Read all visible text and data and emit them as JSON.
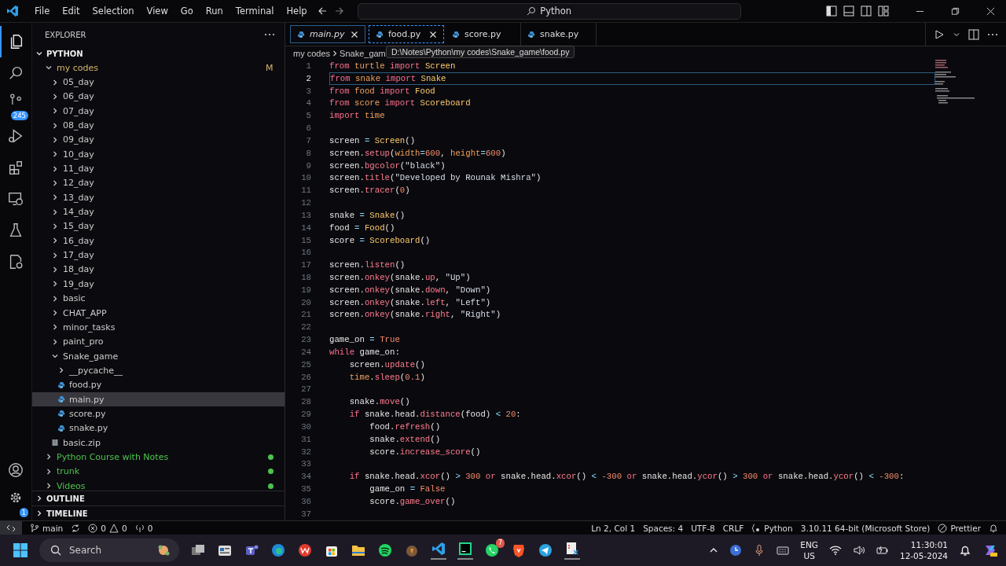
{
  "title_bar": {
    "menu": [
      "File",
      "Edit",
      "Selection",
      "View",
      "Go",
      "Run",
      "Terminal",
      "Help"
    ],
    "search": "Python"
  },
  "activity_bar": {
    "source_control_badge": "245",
    "settings_badge": "1"
  },
  "explorer": {
    "title": "EXPLORER",
    "section": "PYTHON",
    "tree": [
      {
        "label": "my codes",
        "kind": "folder",
        "expanded": true,
        "color": "#d7b46a",
        "decoration": "M",
        "children": [
          {
            "label": "05_day",
            "kind": "folder",
            "expanded": false
          },
          {
            "label": "06_day",
            "kind": "folder",
            "expanded": false
          },
          {
            "label": "07_day",
            "kind": "folder",
            "expanded": false
          },
          {
            "label": "08_day",
            "kind": "folder",
            "expanded": false
          },
          {
            "label": "09_day",
            "kind": "folder",
            "expanded": false
          },
          {
            "label": "10_day",
            "kind": "folder",
            "expanded": false
          },
          {
            "label": "11_day",
            "kind": "folder",
            "expanded": false
          },
          {
            "label": "12_day",
            "kind": "folder",
            "expanded": false
          },
          {
            "label": "13_day",
            "kind": "folder",
            "expanded": false
          },
          {
            "label": "14_day",
            "kind": "folder",
            "expanded": false
          },
          {
            "label": "15_day",
            "kind": "folder",
            "expanded": false
          },
          {
            "label": "16_day",
            "kind": "folder",
            "expanded": false
          },
          {
            "label": "17_day",
            "kind": "folder",
            "expanded": false
          },
          {
            "label": "18_day",
            "kind": "folder",
            "expanded": false
          },
          {
            "label": "19_day",
            "kind": "folder",
            "expanded": false
          },
          {
            "label": "basic",
            "kind": "folder",
            "expanded": false
          },
          {
            "label": "CHAT_APP",
            "kind": "folder",
            "expanded": false
          },
          {
            "label": "minor_tasks",
            "kind": "folder",
            "expanded": false
          },
          {
            "label": "paint_pro",
            "kind": "folder",
            "expanded": false
          },
          {
            "label": "Snake_game",
            "kind": "folder",
            "expanded": true,
            "children": [
              {
                "label": "__pycache__",
                "kind": "folder",
                "expanded": false
              },
              {
                "label": "food.py",
                "kind": "file",
                "selected": false
              },
              {
                "label": "main.py",
                "kind": "file",
                "selected": true
              },
              {
                "label": "score.py",
                "kind": "file",
                "selected": false
              },
              {
                "label": "snake.py",
                "kind": "file",
                "selected": false
              }
            ]
          },
          {
            "label": "basic.zip",
            "kind": "archive",
            "selected": false
          }
        ]
      },
      {
        "label": "Python Course with Notes",
        "kind": "folder",
        "expanded": false,
        "color": "#4cc34c",
        "dot": true
      },
      {
        "label": "trunk",
        "kind": "folder",
        "expanded": false,
        "color": "#4cc34c",
        "dot": true
      },
      {
        "label": "Videos",
        "kind": "folder",
        "expanded": false,
        "color": "#4cc34c",
        "dot": true
      }
    ],
    "panels": [
      "OUTLINE",
      "TIMELINE"
    ]
  },
  "tabs": [
    {
      "label": "main.py",
      "selected": true,
      "preview": true,
      "close_visible": true
    },
    {
      "label": "food.py",
      "selected": false,
      "preview": false,
      "close_visible": true
    },
    {
      "label": "score.py",
      "selected": false,
      "preview": false,
      "close_visible": false
    },
    {
      "label": "snake.py",
      "selected": false,
      "preview": false,
      "close_visible": false
    }
  ],
  "breadcrumb": [
    "my codes",
    "Snake_gam"
  ],
  "tooltip": "D:\\Notes\\Python\\my codes\\Snake_game\\food.py",
  "code": [
    {
      "number": "1",
      "current": false,
      "tokens": [
        {
          "kind": "kw",
          "text": "from "
        },
        {
          "kind": "mod",
          "text": "turtle "
        },
        {
          "kind": "kw",
          "text": "import "
        },
        {
          "kind": "cls",
          "text": "Screen"
        }
      ]
    },
    {
      "number": "2",
      "current": true,
      "tokens": [
        {
          "kind": "kw",
          "text": "from "
        },
        {
          "kind": "mod",
          "text": "snake "
        },
        {
          "kind": "kw",
          "text": "import "
        },
        {
          "kind": "cls",
          "text": "Snake"
        }
      ]
    },
    {
      "number": "3",
      "current": false,
      "tokens": [
        {
          "kind": "kw",
          "text": "from "
        },
        {
          "kind": "mod",
          "text": "food "
        },
        {
          "kind": "kw",
          "text": "import "
        },
        {
          "kind": "cls",
          "text": "Food"
        }
      ]
    },
    {
      "number": "4",
      "current": false,
      "tokens": [
        {
          "kind": "kw",
          "text": "from "
        },
        {
          "kind": "mod",
          "text": "score "
        },
        {
          "kind": "kw",
          "text": "import "
        },
        {
          "kind": "cls",
          "text": "Scoreboard"
        }
      ]
    },
    {
      "number": "5",
      "current": false,
      "tokens": [
        {
          "kind": "kw",
          "text": "import "
        },
        {
          "kind": "mod",
          "text": "time"
        }
      ]
    },
    {
      "number": "6",
      "current": false
    },
    {
      "number": "7",
      "current": false,
      "tokens": [
        {
          "kind": "var",
          "text": "screen "
        },
        {
          "kind": "op",
          "text": "= "
        },
        {
          "kind": "cls",
          "text": "Screen"
        },
        {
          "kind": "var",
          "text": "()"
        }
      ]
    },
    {
      "number": "8",
      "current": false,
      "tokens": [
        {
          "kind": "var",
          "text": "screen."
        },
        {
          "kind": "fn",
          "text": "setup"
        },
        {
          "kind": "var",
          "text": "("
        },
        {
          "kind": "param",
          "text": "width"
        },
        {
          "kind": "op",
          "text": "="
        },
        {
          "kind": "num",
          "text": "600"
        },
        {
          "kind": "var",
          "text": ", "
        },
        {
          "kind": "param",
          "text": "height"
        },
        {
          "kind": "op",
          "text": "="
        },
        {
          "kind": "num",
          "text": "600"
        },
        {
          "kind": "var",
          "text": ")"
        }
      ]
    },
    {
      "number": "9",
      "current": false,
      "tokens": [
        {
          "kind": "var",
          "text": "screen."
        },
        {
          "kind": "fn",
          "text": "bgcolor"
        },
        {
          "kind": "var",
          "text": "("
        },
        {
          "kind": "str",
          "text": "\"black\""
        },
        {
          "kind": "var",
          "text": ")"
        }
      ]
    },
    {
      "number": "10",
      "current": false,
      "tokens": [
        {
          "kind": "var",
          "text": "screen."
        },
        {
          "kind": "fn",
          "text": "title"
        },
        {
          "kind": "var",
          "text": "("
        },
        {
          "kind": "str",
          "text": "\"Developed by Rounak Mishra\""
        },
        {
          "kind": "var",
          "text": ")"
        }
      ]
    },
    {
      "number": "11",
      "current": false,
      "tokens": [
        {
          "kind": "var",
          "text": "screen."
        },
        {
          "kind": "fn",
          "text": "tracer"
        },
        {
          "kind": "var",
          "text": "("
        },
        {
          "kind": "num",
          "text": "0"
        },
        {
          "kind": "var",
          "text": ")"
        }
      ]
    },
    {
      "number": "12",
      "current": false
    },
    {
      "number": "13",
      "current": false,
      "tokens": [
        {
          "kind": "var",
          "text": "snake "
        },
        {
          "kind": "op",
          "text": "= "
        },
        {
          "kind": "cls",
          "text": "Snake"
        },
        {
          "kind": "var",
          "text": "()"
        }
      ]
    },
    {
      "number": "14",
      "current": false,
      "tokens": [
        {
          "kind": "var",
          "text": "food "
        },
        {
          "kind": "op",
          "text": "= "
        },
        {
          "kind": "cls",
          "text": "Food"
        },
        {
          "kind": "var",
          "text": "()"
        }
      ]
    },
    {
      "number": "15",
      "current": false,
      "tokens": [
        {
          "kind": "var",
          "text": "score "
        },
        {
          "kind": "op",
          "text": "= "
        },
        {
          "kind": "cls",
          "text": "Scoreboard"
        },
        {
          "kind": "var",
          "text": "()"
        }
      ]
    },
    {
      "number": "16",
      "current": false
    },
    {
      "number": "17",
      "current": false,
      "tokens": [
        {
          "kind": "var",
          "text": "screen."
        },
        {
          "kind": "fn",
          "text": "listen"
        },
        {
          "kind": "var",
          "text": "()"
        }
      ]
    },
    {
      "number": "18",
      "current": false,
      "tokens": [
        {
          "kind": "var",
          "text": "screen."
        },
        {
          "kind": "fn",
          "text": "onkey"
        },
        {
          "kind": "var",
          "text": "(snake."
        },
        {
          "kind": "fn",
          "text": "up"
        },
        {
          "kind": "var",
          "text": ", "
        },
        {
          "kind": "str",
          "text": "\"Up\""
        },
        {
          "kind": "var",
          "text": ")"
        }
      ]
    },
    {
      "number": "19",
      "current": false,
      "tokens": [
        {
          "kind": "var",
          "text": "screen."
        },
        {
          "kind": "fn",
          "text": "onkey"
        },
        {
          "kind": "var",
          "text": "(snake."
        },
        {
          "kind": "fn",
          "text": "down"
        },
        {
          "kind": "var",
          "text": ", "
        },
        {
          "kind": "str",
          "text": "\"Down\""
        },
        {
          "kind": "var",
          "text": ")"
        }
      ]
    },
    {
      "number": "20",
      "current": false,
      "tokens": [
        {
          "kind": "var",
          "text": "screen."
        },
        {
          "kind": "fn",
          "text": "onkey"
        },
        {
          "kind": "var",
          "text": "(snake."
        },
        {
          "kind": "fn",
          "text": "left"
        },
        {
          "kind": "var",
          "text": ", "
        },
        {
          "kind": "str",
          "text": "\"Left\""
        },
        {
          "kind": "var",
          "text": ")"
        }
      ]
    },
    {
      "number": "21",
      "current": false,
      "tokens": [
        {
          "kind": "var",
          "text": "screen."
        },
        {
          "kind": "fn",
          "text": "onkey"
        },
        {
          "kind": "var",
          "text": "(snake."
        },
        {
          "kind": "fn",
          "text": "right"
        },
        {
          "kind": "var",
          "text": ", "
        },
        {
          "kind": "str",
          "text": "\"Right\""
        },
        {
          "kind": "var",
          "text": ")"
        }
      ]
    },
    {
      "number": "22",
      "current": false
    },
    {
      "number": "23",
      "current": false,
      "tokens": [
        {
          "kind": "var",
          "text": "game_on "
        },
        {
          "kind": "op",
          "text": "= "
        },
        {
          "kind": "num",
          "text": "True"
        }
      ]
    },
    {
      "number": "24",
      "current": false,
      "tokens": [
        {
          "kind": "kw",
          "text": "while "
        },
        {
          "kind": "var",
          "text": "game_on:"
        }
      ]
    },
    {
      "number": "25",
      "current": false,
      "tokens": [
        {
          "kind": "var",
          "text": "    screen."
        },
        {
          "kind": "fn",
          "text": "update"
        },
        {
          "kind": "var",
          "text": "()"
        }
      ]
    },
    {
      "number": "26",
      "current": false,
      "tokens": [
        {
          "kind": "mod",
          "text": "    time"
        },
        {
          "kind": "var",
          "text": "."
        },
        {
          "kind": "fn",
          "text": "sleep"
        },
        {
          "kind": "var",
          "text": "("
        },
        {
          "kind": "num",
          "text": "0.1"
        },
        {
          "kind": "var",
          "text": ")"
        }
      ]
    },
    {
      "number": "27",
      "current": false
    },
    {
      "number": "28",
      "current": false,
      "tokens": [
        {
          "kind": "var",
          "text": "    snake."
        },
        {
          "kind": "fn",
          "text": "move"
        },
        {
          "kind": "var",
          "text": "()"
        }
      ]
    },
    {
      "number": "29",
      "current": false,
      "tokens": [
        {
          "kind": "kw",
          "text": "    if "
        },
        {
          "kind": "var",
          "text": "snake.head."
        },
        {
          "kind": "fn",
          "text": "distance"
        },
        {
          "kind": "var",
          "text": "(food) "
        },
        {
          "kind": "op",
          "text": "< "
        },
        {
          "kind": "num",
          "text": "20"
        },
        {
          "kind": "var",
          "text": ":"
        }
      ]
    },
    {
      "number": "30",
      "current": false,
      "tokens": [
        {
          "kind": "var",
          "text": "        food."
        },
        {
          "kind": "fn",
          "text": "refresh"
        },
        {
          "kind": "var",
          "text": "()"
        }
      ]
    },
    {
      "number": "31",
      "current": false,
      "tokens": [
        {
          "kind": "var",
          "text": "        snake."
        },
        {
          "kind": "fn",
          "text": "extend"
        },
        {
          "kind": "var",
          "text": "()"
        }
      ]
    },
    {
      "number": "32",
      "current": false,
      "tokens": [
        {
          "kind": "var",
          "text": "        score."
        },
        {
          "kind": "fn",
          "text": "increase_score"
        },
        {
          "kind": "var",
          "text": "()"
        }
      ]
    },
    {
      "number": "33",
      "current": false
    },
    {
      "number": "34",
      "current": false,
      "tokens": [
        {
          "kind": "kw",
          "text": "    if "
        },
        {
          "kind": "var",
          "text": "snake.head."
        },
        {
          "kind": "fn",
          "text": "xcor"
        },
        {
          "kind": "var",
          "text": "() "
        },
        {
          "kind": "op",
          "text": "> "
        },
        {
          "kind": "num",
          "text": "300 "
        },
        {
          "kind": "kw",
          "text": "or "
        },
        {
          "kind": "var",
          "text": "snake.head."
        },
        {
          "kind": "fn",
          "text": "xcor"
        },
        {
          "kind": "var",
          "text": "() "
        },
        {
          "kind": "op",
          "text": "< "
        },
        {
          "kind": "num",
          "text": "-300 "
        },
        {
          "kind": "kw",
          "text": "or "
        },
        {
          "kind": "var",
          "text": "snake.head."
        },
        {
          "kind": "fn",
          "text": "ycor"
        },
        {
          "kind": "var",
          "text": "() "
        },
        {
          "kind": "op",
          "text": "> "
        },
        {
          "kind": "num",
          "text": "300 "
        },
        {
          "kind": "kw",
          "text": "or "
        },
        {
          "kind": "var",
          "text": "snake.head."
        },
        {
          "kind": "fn",
          "text": "ycor"
        },
        {
          "kind": "var",
          "text": "() "
        },
        {
          "kind": "op",
          "text": "< "
        },
        {
          "kind": "num",
          "text": "-300"
        },
        {
          "kind": "var",
          "text": ":"
        }
      ]
    },
    {
      "number": "35",
      "current": false,
      "tokens": [
        {
          "kind": "var",
          "text": "        game_on "
        },
        {
          "kind": "op",
          "text": "= "
        },
        {
          "kind": "num",
          "text": "False"
        }
      ]
    },
    {
      "number": "36",
      "current": false,
      "tokens": [
        {
          "kind": "var",
          "text": "        score."
        },
        {
          "kind": "fn",
          "text": "game_over"
        },
        {
          "kind": "var",
          "text": "()"
        }
      ]
    },
    {
      "number": "37",
      "current": false
    }
  ],
  "status_bar": {
    "branch": "main",
    "errors": "0",
    "warnings": "0",
    "ports": "0",
    "position": "Ln 2, Col 1",
    "indent": "Spaces: 4",
    "encoding": "UTF-8",
    "eol": "CRLF",
    "language": "Python",
    "interpreter": "3.10.11 64-bit (Microsoft Store)",
    "formatter": "Prettier"
  },
  "taskbar": {
    "search_placeholder": "Search",
    "whatsapp_badge": "7",
    "language": "ENG",
    "region": "US",
    "time": "11:30:01",
    "date": "12-05-2024"
  }
}
